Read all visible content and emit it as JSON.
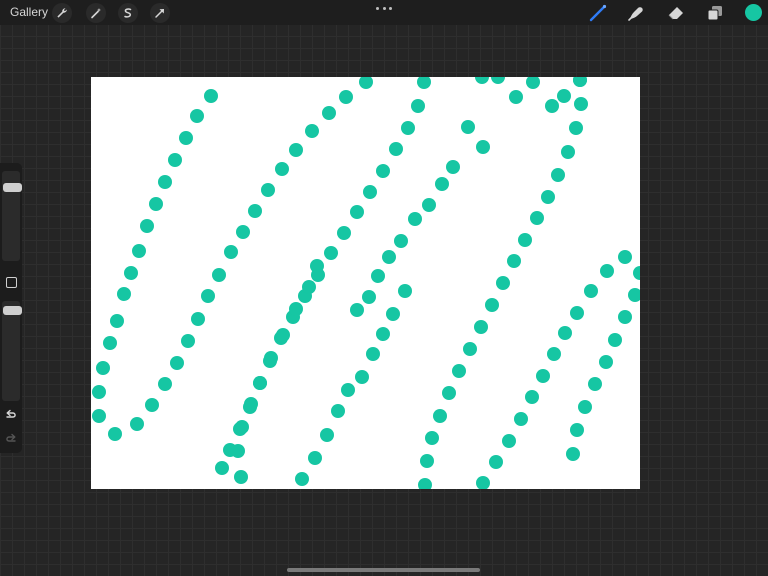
{
  "app": {
    "gallery_label": "Gallery"
  },
  "toolbar": {
    "left_tools": [
      "wrench-icon",
      "magic-wand-icon",
      "selection-icon",
      "transform-arrow-icon"
    ],
    "right_tools": [
      "brush-icon",
      "smudge-icon",
      "eraser-icon",
      "layers-icon"
    ],
    "active_tool": "brush-icon",
    "more_menu": "more-dots-icon"
  },
  "colors": {
    "current_color": "#16c6a3",
    "brush_active": "#2f7cf6",
    "canvas_background": "#ffffff",
    "dot_color": "#16c6a3"
  },
  "sidebar": {
    "brush_size_level": 0.85,
    "opacity_level": 0.95,
    "icons": [
      "modify-square-icon",
      "undo-icon",
      "redo-icon"
    ]
  }
}
